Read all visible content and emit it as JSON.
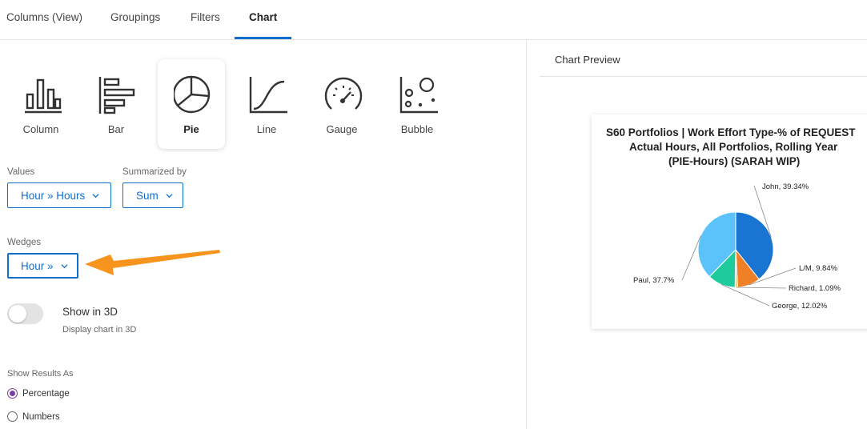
{
  "tabs": [
    {
      "label": "Columns (View)",
      "active": false
    },
    {
      "label": "Groupings",
      "active": false
    },
    {
      "label": "Filters",
      "active": false
    },
    {
      "label": "Chart",
      "active": true
    }
  ],
  "chart_types": [
    {
      "label": "Column",
      "icon": "column-chart-icon",
      "selected": false
    },
    {
      "label": "Bar",
      "icon": "bar-chart-icon",
      "selected": false
    },
    {
      "label": "Pie",
      "icon": "pie-chart-icon",
      "selected": true
    },
    {
      "label": "Line",
      "icon": "line-chart-icon",
      "selected": false
    },
    {
      "label": "Gauge",
      "icon": "gauge-chart-icon",
      "selected": false
    },
    {
      "label": "Bubble",
      "icon": "bubble-chart-icon",
      "selected": false
    }
  ],
  "values": {
    "label": "Values",
    "value": "Hour » Hours"
  },
  "summarized": {
    "label": "Summarized by",
    "value": "Sum"
  },
  "wedges": {
    "label": "Wedges",
    "value": "Hour »"
  },
  "show3d": {
    "title": "Show in 3D",
    "subtitle": "Display chart in 3D",
    "on": false
  },
  "results": {
    "label": "Show Results As",
    "options": [
      {
        "label": "Percentage",
        "checked": true
      },
      {
        "label": "Numbers",
        "checked": false
      }
    ]
  },
  "preview": {
    "title": "Chart Preview"
  },
  "annotation": {
    "arrow_color": "#f7941d"
  },
  "colors": {
    "accent": "#0e6fcf",
    "radio": "#7b3fa0"
  },
  "chart_data": {
    "type": "pie",
    "title_lines": [
      "S60 Portfolios | Work Effort Type-% of REQUEST",
      "Actual Hours, All Portfolios, Rolling Year",
      "(PIE-Hours) (SARAH WIP)"
    ],
    "slices": [
      {
        "name": "John",
        "value": 39.34,
        "label": "John, 39.34%",
        "color": "#1a75d2"
      },
      {
        "name": "L/M",
        "value": 9.84,
        "label": "L/M, 9.84%",
        "color": "#f07f26"
      },
      {
        "name": "Richard",
        "value": 1.09,
        "label": "Richard, 1.09%",
        "color": "#f4d53a"
      },
      {
        "name": "George",
        "value": 12.02,
        "label": "George, 12.02%",
        "color": "#1ecb9c"
      },
      {
        "name": "Paul",
        "value": 37.7,
        "label": "Paul, 37.7%",
        "color": "#5bc3fa"
      }
    ]
  }
}
